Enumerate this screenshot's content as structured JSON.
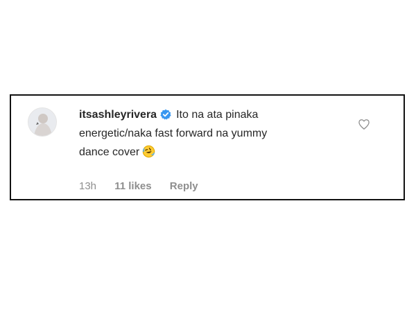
{
  "comment": {
    "username": "itsashleyrivera",
    "verified": true,
    "text_line1": "Ito na ata pinaka",
    "text_line2": "energetic/naka fast forward na yummy",
    "text_line3": "dance cover",
    "emoji_icon": "rolling-on-floor-laughing-emoji",
    "timestamp": "13h",
    "likes": "11 likes",
    "reply_label": "Reply"
  },
  "colors": {
    "verified_badge": "#3897f0",
    "meta_text": "#8e8e8e",
    "text": "#262626"
  }
}
